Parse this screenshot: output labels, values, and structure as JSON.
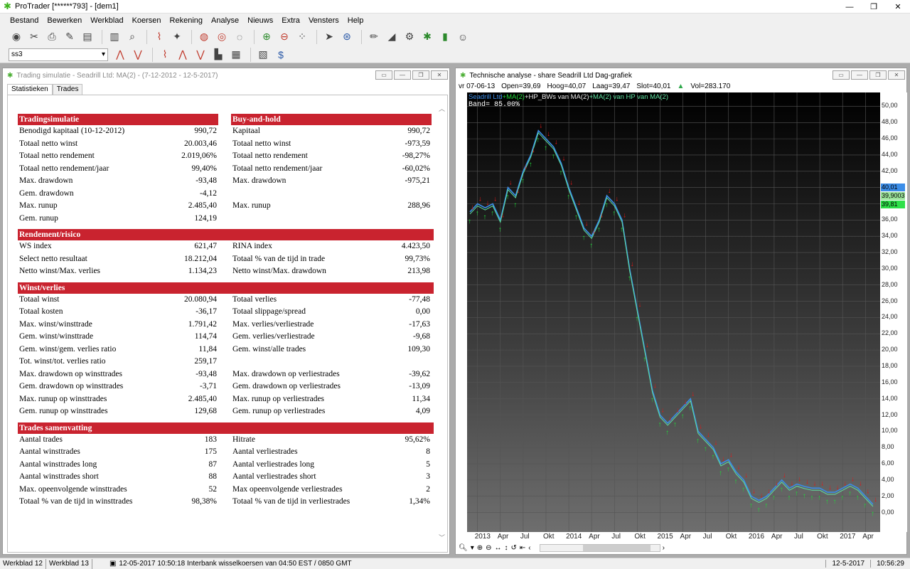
{
  "window": {
    "title": "ProTrader [******793] - [dem1]"
  },
  "menu": [
    "Bestand",
    "Bewerken",
    "Werkblad",
    "Koersen",
    "Rekening",
    "Analyse",
    "Nieuws",
    "Extra",
    "Vensters",
    "Help"
  ],
  "toolbar": {
    "symbol_dropdown": "ss3"
  },
  "sim_window": {
    "title": "Trading simulatie - Seadrill Ltd: MA(2) - (7-12-2012 - 12-5-2017)",
    "tabs": [
      "Statistieken",
      "Trades"
    ],
    "left_sections": [
      {
        "header": "Tradingsimulatie",
        "rows": [
          [
            "Benodigd kapitaal (10-12-2012)",
            "990,72"
          ],
          [
            "Totaal netto winst",
            "20.003,46"
          ],
          [
            "Totaal netto rendement",
            "2.019,06%"
          ],
          [
            "Totaal netto rendement/jaar",
            "99,40%"
          ],
          [
            "Max. drawdown",
            "-93,48"
          ],
          [
            "Gem. drawdown",
            "-4,12"
          ],
          [
            "Max. runup",
            "2.485,40"
          ],
          [
            "Gem. runup",
            "124,19"
          ]
        ]
      }
    ],
    "right_sections": [
      {
        "header": "Buy-and-hold",
        "rows": [
          [
            "Kapitaal",
            "990,72"
          ],
          [
            "Totaal netto winst",
            "-973,59"
          ],
          [
            "Totaal netto rendement",
            "-98,27%"
          ],
          [
            "Totaal netto rendement/jaar",
            "-60,02%"
          ],
          [
            "Max. drawdown",
            "-975,21"
          ],
          [
            "",
            ""
          ],
          [
            "Max. runup",
            "288,96"
          ],
          [
            "",
            ""
          ]
        ]
      }
    ],
    "rendement": {
      "header": "Rendement/risico",
      "left": [
        [
          "WS index",
          "621,47"
        ],
        [
          "Select netto resultaat",
          "18.212,04"
        ],
        [
          "Netto winst/Max. verlies",
          "1.134,23"
        ]
      ],
      "right": [
        [
          "RINA index",
          "4.423,50"
        ],
        [
          "Totaal % van de tijd in trade",
          "99,73%"
        ],
        [
          "Netto winst/Max. drawdown",
          "213,98"
        ]
      ]
    },
    "winst": {
      "header": "Winst/verlies",
      "left": [
        [
          "Totaal winst",
          "20.080,94"
        ],
        [
          "Totaal kosten",
          "-36,17"
        ],
        [
          "Max. winst/winsttrade",
          "1.791,42"
        ],
        [
          "Gem. winst/winsttrade",
          "114,74"
        ],
        [
          "Gem. winst/gem. verlies ratio",
          "11,84"
        ],
        [
          "Tot. winst/tot. verlies ratio",
          "259,17"
        ],
        [
          "Max. drawdown op winsttrades",
          "-93,48"
        ],
        [
          "Gem. drawdown op winsttrades",
          "-3,71"
        ],
        [
          "Max. runup op winsttrades",
          "2.485,40"
        ],
        [
          "Gem. runup op winsttrades",
          "129,68"
        ]
      ],
      "right": [
        [
          "Totaal verlies",
          "-77,48"
        ],
        [
          "Totaal slippage/spread",
          "0,00"
        ],
        [
          "Max. verlies/verliestrade",
          "-17,63"
        ],
        [
          "Gem. verlies/verliestrade",
          "-9,68"
        ],
        [
          "Gem. winst/alle trades",
          "109,30"
        ],
        [
          "",
          ""
        ],
        [
          "Max. drawdown op verliestrades",
          "-39,62"
        ],
        [
          "Gem. drawdown op verliestrades",
          "-13,09"
        ],
        [
          "Max. runup op verliestrades",
          "11,34"
        ],
        [
          "Gem. runup op verliestrades",
          "4,09"
        ]
      ]
    },
    "trades": {
      "header": "Trades samenvatting",
      "left": [
        [
          "Aantal trades",
          "183"
        ],
        [
          "Aantal winsttrades",
          "175"
        ],
        [
          "Aantal winsttrades long",
          "87"
        ],
        [
          "Aantal winsttrades short",
          "88"
        ],
        [
          "Max. opeenvolgende winsttrades",
          "52"
        ],
        [
          "Totaal % van de tijd in winsttrades",
          "98,38%"
        ]
      ],
      "right": [
        [
          "Hitrate",
          "95,62%"
        ],
        [
          "Aantal verliestrades",
          "8"
        ],
        [
          "Aantal verliestrades long",
          "5"
        ],
        [
          "Aantal verliestrades short",
          "3"
        ],
        [
          "Max opeenvolgende verliestrades",
          "2"
        ],
        [
          "Totaal % van de tijd in verliestrades",
          "1,34%"
        ]
      ]
    }
  },
  "chart_window": {
    "title": "Technische analyse - share Seadrill Ltd Dag-grafiek",
    "info": {
      "date": "vr 07-06-13",
      "open": "Open=39,69",
      "high": "Hoog=40,07",
      "low": "Laag=39,47",
      "close": "Slot=40,01",
      "vol": "Vol=283.170"
    },
    "legend": {
      "part1": "Seadrill Ltd",
      "part2": "+MA(2)",
      "part3": "+HP_BWs van MA(2)",
      "part4": "+MA(2) van HP van MA(2)"
    },
    "band": "Band= 85.00%",
    "price_labels": [
      "40,01",
      "39,9003",
      "39,81"
    ],
    "price_label_colors": [
      "#3b8de8",
      "#9be39b",
      "#2ee04a"
    ],
    "colors": {
      "up": "#21d63a",
      "down": "#e01818",
      "ma": "#3b8de8",
      "hp": "#5fe0a0"
    }
  },
  "chart_data": {
    "type": "line",
    "title": "",
    "xlabel": "",
    "ylabel": "",
    "x_ticks": [
      "2013",
      "Apr",
      "Jul",
      "Okt",
      "2014",
      "Apr",
      "Jul",
      "Okt",
      "2015",
      "Apr",
      "Jul",
      "Okt",
      "2016",
      "Apr",
      "Jul",
      "Okt",
      "2017",
      "Apr"
    ],
    "y_ticks": [
      "50,00",
      "48,00",
      "46,00",
      "44,00",
      "42,00",
      "40,00",
      "38,00",
      "36,00",
      "34,00",
      "32,00",
      "30,00",
      "28,00",
      "26,00",
      "24,00",
      "22,00",
      "20,00",
      "18,00",
      "16,00",
      "14,00",
      "12,00",
      "10,00",
      "8,00",
      "6,00",
      "4,00",
      "2,00",
      "0,00"
    ],
    "ylim": [
      -1,
      51
    ],
    "grid": true,
    "series": [
      {
        "x": [
          "2012-12",
          "2013-01",
          "2013-02",
          "2013-03",
          "2013-04",
          "2013-05",
          "2013-06",
          "2013-07",
          "2013-08",
          "2013-09",
          "2013-10",
          "2013-11",
          "2013-12",
          "2014-01",
          "2014-02",
          "2014-03",
          "2014-04",
          "2014-05",
          "2014-06",
          "2014-07",
          "2014-08",
          "2014-09",
          "2014-10",
          "2014-11",
          "2014-12",
          "2015-01",
          "2015-02",
          "2015-03",
          "2015-04",
          "2015-05",
          "2015-06",
          "2015-07",
          "2015-08",
          "2015-09",
          "2015-10",
          "2015-11",
          "2015-12",
          "2016-01",
          "2016-02",
          "2016-03",
          "2016-04",
          "2016-05",
          "2016-06",
          "2016-07",
          "2016-08",
          "2016-09",
          "2016-10",
          "2016-11",
          "2016-12",
          "2017-01",
          "2017-02",
          "2017-03",
          "2017-04",
          "2017-05"
        ],
        "y": [
          37,
          38,
          37.5,
          38,
          36,
          40,
          39,
          42,
          44,
          47,
          46,
          45,
          43,
          40,
          37.5,
          35,
          34,
          36,
          39,
          38,
          36,
          30,
          25,
          20,
          15,
          12,
          11,
          12,
          13,
          14,
          10,
          9,
          8,
          6,
          6.5,
          5,
          4,
          2,
          1.5,
          2,
          3,
          4,
          3,
          3.5,
          3.2,
          3,
          3,
          2.5,
          2.5,
          3,
          3.5,
          3,
          2,
          1
        ]
      }
    ]
  },
  "statusbar": {
    "tabs": [
      "Werkblad 12",
      "Werkblad 13"
    ],
    "message": "12-05-2017 10:50:18 Interbank wisselkoersen van 04:50 EST / 0850 GMT",
    "date": "12-5-2017",
    "time": "10:56:29"
  }
}
